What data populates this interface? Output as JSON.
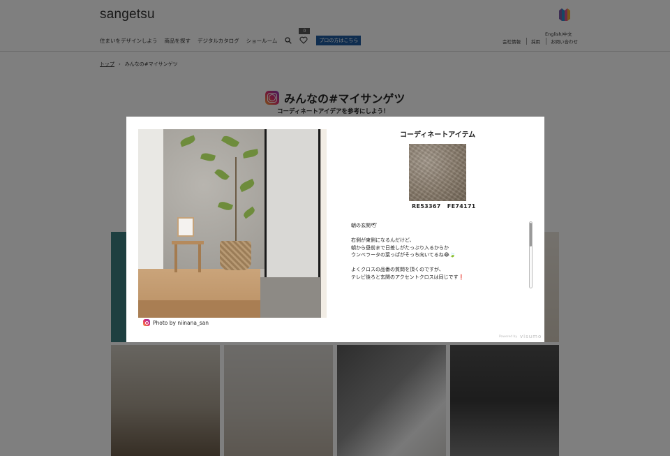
{
  "header": {
    "logo": "sangetsu",
    "nav": [
      "住まいをデザインしよう",
      "商品を探す",
      "デジタルカタログ",
      "ショールーム"
    ],
    "favorites_count": "0",
    "pro_button": "プロの方はこちら",
    "language": "English/中文",
    "corporate_links": [
      "会社情報",
      "採用",
      "お問い合わせ"
    ]
  },
  "breadcrumb": {
    "home": "トップ",
    "separator": "›",
    "current": "みんなの#マイサンゲツ"
  },
  "page": {
    "title": "みんなの#マイサンゲツ",
    "subtitle": "コーディネートアイデアを参考にしよう！"
  },
  "modal": {
    "photo_credit": "Photo by niinana_san",
    "coordinate_title": "コーディネートアイテム",
    "product_codes": "RE53367   FE74171",
    "caption_lines": [
      "朝の玄関🕊",
      "",
      "右側が東側になるんだけど、",
      "朝から昼前まで日差しがたっぷり入るからか",
      "ウンベラータの葉っぱがそっち向いてるね😂🍃",
      "",
      "よくクロスの品番の質問を頂くのですが、",
      "テレビ後ろと玄関のアクセントクロスは同じです❗️"
    ],
    "powered_by": "Powered by",
    "provider": "visumo"
  },
  "icons": {
    "search": "search-icon",
    "favorite": "heart-icon",
    "close": "close-icon",
    "instagram": "instagram-icon"
  },
  "colors": {
    "pro_button": "#1e5a9e",
    "overlay": "rgba(0,0,0,0.5)"
  }
}
